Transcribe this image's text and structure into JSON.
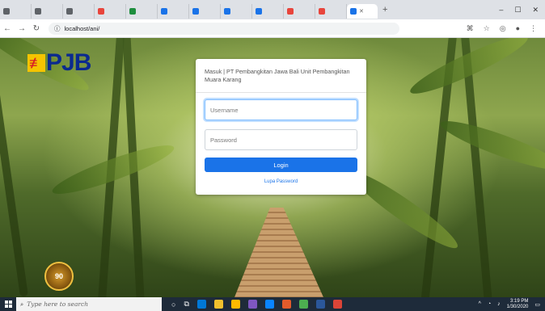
{
  "browser": {
    "tabs": [
      {
        "label": "",
        "favicon_color": "#5f6368"
      },
      {
        "label": "",
        "favicon_color": "#5f6368"
      },
      {
        "label": "",
        "favicon_color": "#5f6368"
      },
      {
        "label": "",
        "favicon_color": "#e8453c"
      },
      {
        "label": "",
        "favicon_color": "#1e8e3e"
      },
      {
        "label": "",
        "favicon_color": "#1a73e8"
      },
      {
        "label": "",
        "favicon_color": "#1a73e8"
      },
      {
        "label": "",
        "favicon_color": "#1a73e8"
      },
      {
        "label": "",
        "favicon_color": "#1a73e8"
      },
      {
        "label": "",
        "favicon_color": "#e8453c"
      },
      {
        "label": "",
        "favicon_color": "#e8453c"
      }
    ],
    "address": "localhost/ani/"
  },
  "page": {
    "logo_text": "PJB",
    "login": {
      "title": "Masuk | PT Pembangkitan Jawa Bali Unit Pembangkitan Muara Karang",
      "username_placeholder": "Username",
      "password_placeholder": "Password",
      "login_button": "Login",
      "forgot_link": "Lupa Password"
    },
    "badge_text": "90"
  },
  "taskbar": {
    "search_placeholder": "Type here to search",
    "clock_time": "3:19 PM",
    "clock_date": "1/30/2020",
    "pinned_colors": [
      "#0078d7",
      "#f2c12e",
      "#ffb900",
      "#7e57c2",
      "#0a84ff",
      "#e35b2b",
      "#4caf50",
      "#2b579a",
      "#db4437"
    ]
  }
}
